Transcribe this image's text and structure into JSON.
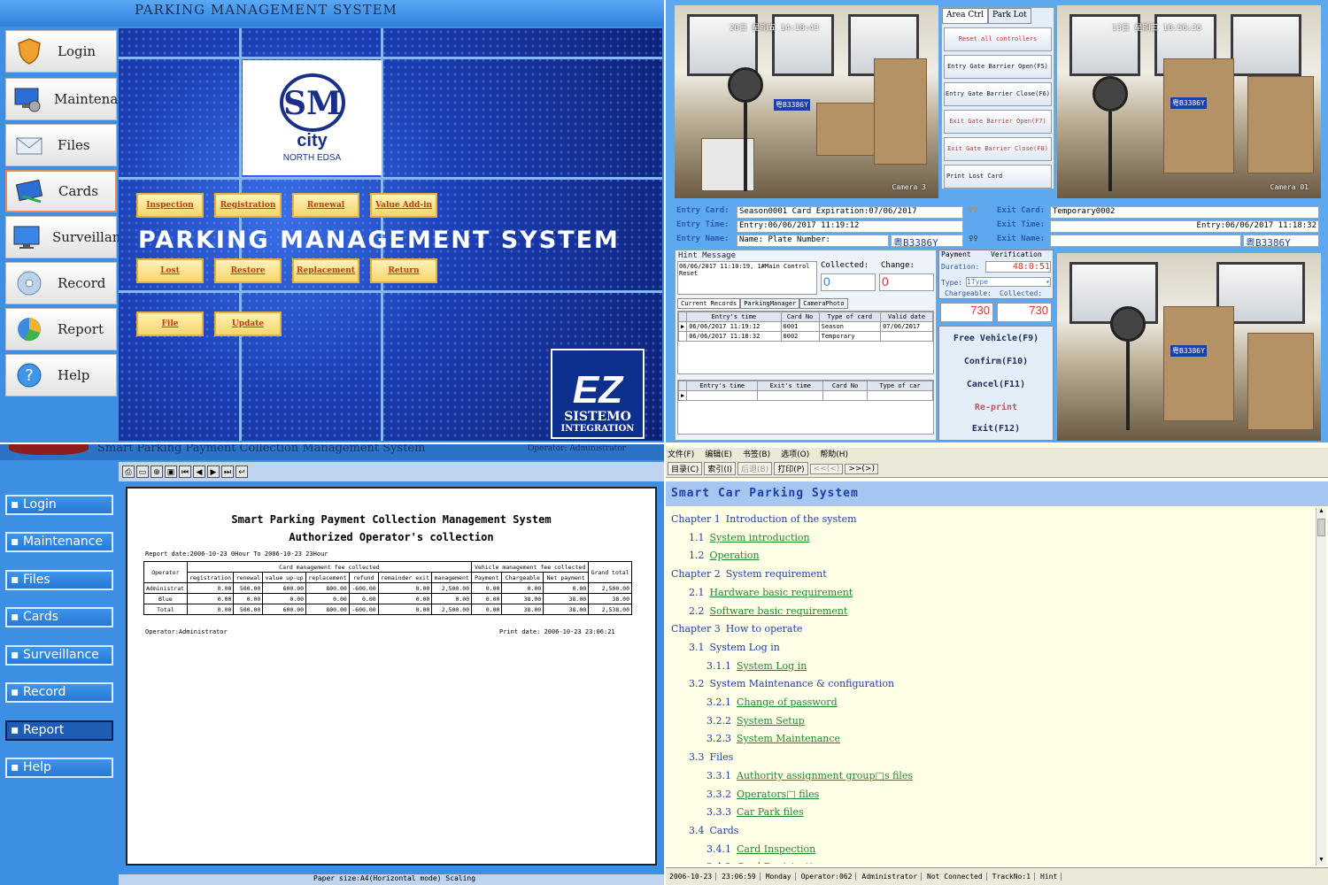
{
  "q1": {
    "title": "PARKING MANAGEMENT SYSTEM",
    "sidebar": [
      "Login",
      "Maintenance",
      "Files",
      "Cards",
      "Surveillance",
      "Record",
      "Report",
      "Help"
    ],
    "active_item": "Cards",
    "logo": {
      "mark": "SM",
      "city": "city",
      "sub": "NORTH EDSA"
    },
    "banner": "PARKING MANAGEMENT SYSTEM",
    "buttons_row1": [
      "Inspection",
      "Registration",
      "Renewal",
      "Value Add-in"
    ],
    "buttons_row2": [
      "Lost",
      "Restore",
      "Replacement",
      "Return"
    ],
    "buttons_row3": [
      "File",
      "Update"
    ],
    "brand": {
      "mark": "EZ",
      "line1": "SISTEMO",
      "line2": "INTEGRATION"
    }
  },
  "q2": {
    "cam_left": {
      "timestamp": "20日 星期五 14:18:43",
      "label": "Camera 3",
      "plate": "粤B3386Y"
    },
    "cam_right": {
      "timestamp": "13日 星期三 10:56:36",
      "label": "Camera 01",
      "plate": "粤B3386Y"
    },
    "cam_bottom": {
      "plate": "粤B3386Y"
    },
    "ctrl_tabs": [
      "Area Ctrl",
      "Park Lot"
    ],
    "ctrl_buttons": [
      "Reset all controllers",
      "Entry Gate Barrier Open(F5)",
      "Entry Gate Barrier Close(F6)",
      "Exit Gate Barrier Open(F7)",
      "Exit Gate Barrier Close(F8)",
      "Print Lost Card"
    ],
    "entry": {
      "card_label": "Entry Card:",
      "card_value": "Season0001 Card Expiration:07/06/2017",
      "time_label": "Entry Time:",
      "time_value": "Entry:06/06/2017 11:19:12",
      "name_label": "Entry Name:",
      "name_value": "Name:  Plate Number:",
      "plate": "粤B3386Y"
    },
    "exit": {
      "card_label": "Exit Card:",
      "card_value": "Temporary0002",
      "time_label": "Exit Time:",
      "time_value": "Entry:06/06/2017 11:18:32",
      "name_label": "Exit Name:",
      "plate": "粤B3386Y"
    },
    "hint": {
      "title": "Hint Message",
      "text": "06/06/2017 11:10:19, 1#Main Control Reset",
      "collected_label": "Collected:",
      "change_label": "Change:",
      "collected": "0",
      "change": "0"
    },
    "record_tabs": [
      "Current Records",
      "ParkingManager",
      "CameraPhoto"
    ],
    "records_head": [
      "Entry's time",
      "Card No",
      "Type of card",
      "Valid date"
    ],
    "records": [
      [
        "06/06/2017 11:19:12",
        "0001",
        "Season",
        "07/06/2017"
      ],
      [
        "06/06/2017 11:18:32",
        "0002",
        "Temporary",
        ""
      ]
    ],
    "exit_head": [
      "Entry's time",
      "Exit's time",
      "Card No",
      "Type of car"
    ],
    "payment": {
      "title": "Payment",
      "verify": "Verification",
      "duration_label": "Duration:",
      "duration": "48:0:51",
      "type_label": "Type:",
      "type": "1Type",
      "chargeable_label": "Chargeable:",
      "collected_label": "Collected:",
      "chargeable": "730",
      "collected": "730"
    },
    "pay_buttons": [
      "Free Vehicle(F9)",
      "Confirm(F10)",
      "Cancel(F11)",
      "Re-print",
      "Exit(F12)"
    ]
  },
  "q3": {
    "app_title": "Smart Parking Payment Collection Management System",
    "app_right": "Operator: Administrator",
    "nav": [
      "Login",
      "Maintenance",
      "Files",
      "Cards",
      "Surveillance",
      "Record",
      "Report",
      "Help"
    ],
    "active_nav": "Report",
    "report_title": "Smart Parking Payment Collection Management System",
    "report_sub": "Authorized Operator's collection",
    "report_date": "Report date:2006-10-23 0Hour To 2006-10-23 23Hour",
    "group1": "Card management fee collected",
    "group2": "Vehicle management fee collected",
    "cols": [
      "Operator",
      "registration",
      "renewal",
      "value up-up",
      "replacement",
      "refund",
      "remainder exit",
      "management",
      "Payment",
      "Chargeable",
      "Net payment",
      "Grand total"
    ],
    "rows": [
      [
        "Administrat",
        "0.00",
        "500.00",
        "600.00",
        "800.00",
        "-600.00",
        "0.00",
        "2,500.00",
        "0.00",
        "0.00",
        "0.00",
        "2,500.00"
      ],
      [
        "Blue",
        "0.00",
        "0.00",
        "0.00",
        "0.00",
        "0.00",
        "0.00",
        "0.00",
        "0.00",
        "38.00",
        "38.00",
        "38.00"
      ],
      [
        "Total",
        "0.00",
        "500.00",
        "600.00",
        "800.00",
        "-600.00",
        "0.00",
        "2,500.00",
        "0.00",
        "38.00",
        "38.00",
        "2,538.00"
      ]
    ],
    "operator": "Operator:Administrator",
    "print_date": "Print date: 2006-10-23 23:06:21",
    "status": "Paper size:A4(Horizontal mode)      Scaling"
  },
  "q4": {
    "menu": [
      "文件(F)",
      "编辑(E)",
      "书签(B)",
      "选项(O)",
      "帮助(H)"
    ],
    "toolbar": [
      "目录(C)",
      "索引(I)",
      "后退(B)",
      "打印(P)",
      "<<(<)",
      ">>(>)"
    ],
    "header": "Smart Car Parking System",
    "toc": [
      {
        "num": "Chapter 1",
        "text": "Introduction of the system",
        "link": false,
        "indent": 0
      },
      {
        "num": "1.1",
        "text": "System introduction",
        "link": true,
        "indent": 1
      },
      {
        "num": "1.2",
        "text": "Operation",
        "link": true,
        "indent": 1
      },
      {
        "num": "Chapter 2",
        "text": "System requirement",
        "link": false,
        "indent": 0
      },
      {
        "num": "2.1",
        "text": "Hardware basic requirement",
        "link": true,
        "indent": 1
      },
      {
        "num": "2.2",
        "text": "Software basic requirement",
        "link": true,
        "indent": 1
      },
      {
        "num": "Chapter 3",
        "text": "How to operate",
        "link": false,
        "indent": 0
      },
      {
        "num": "3.1",
        "text": "System Log in",
        "link": false,
        "indent": 1
      },
      {
        "num": "3.1.1",
        "text": "System Log in",
        "link": true,
        "indent": 2
      },
      {
        "num": "3.2",
        "text": "System Maintenance & configuration",
        "link": false,
        "indent": 1
      },
      {
        "num": "3.2.1",
        "text": "Change of password",
        "link": true,
        "indent": 2
      },
      {
        "num": "3.2.2",
        "text": "System Setup",
        "link": true,
        "indent": 2
      },
      {
        "num": "3.2.3",
        "text": "System Maintenance",
        "link": true,
        "indent": 2
      },
      {
        "num": "3.3",
        "text": "Files",
        "link": false,
        "indent": 1
      },
      {
        "num": "3.3.1",
        "text": "Authority assignment group□s files",
        "link": true,
        "indent": 2
      },
      {
        "num": "3.3.2",
        "text": "Operators□ files",
        "link": true,
        "indent": 2
      },
      {
        "num": "3.3.3",
        "text": "Car Park files",
        "link": true,
        "indent": 2
      },
      {
        "num": "3.4",
        "text": "Cards",
        "link": false,
        "indent": 1
      },
      {
        "num": "3.4.1",
        "text": "Card Inspection",
        "link": true,
        "indent": 2
      },
      {
        "num": "3.4.2",
        "text": "Card Registration",
        "link": true,
        "indent": 2
      }
    ],
    "status": [
      "2006-10-23",
      "23:06:59",
      "Monday",
      "Operator:062",
      "Administrator",
      "Not Connected",
      "TrackNo:1",
      "Hint"
    ]
  },
  "colors": {
    "panel_blue": "#3d8fe3",
    "dark_blue": "#0c1f73",
    "button_gold": "#f6d56c",
    "link_green": "#1d8a2d",
    "help_bg": "#ffffe8"
  }
}
